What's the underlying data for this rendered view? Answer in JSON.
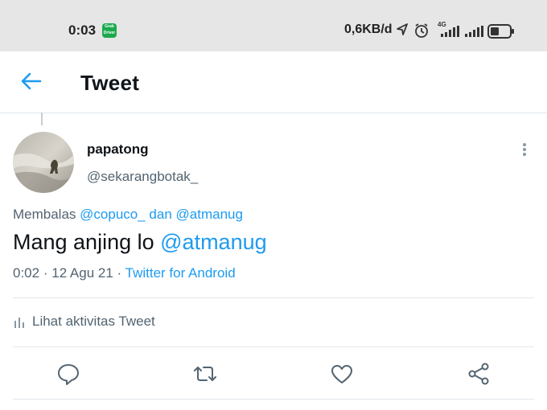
{
  "status_bar": {
    "time": "0:03",
    "grab_app_label": "Grab Driver",
    "network_speed": "0,6KB/d",
    "network_type": "4G",
    "icons": [
      "location-arrow-icon",
      "alarm-icon",
      "signal-4g-icon",
      "signal-icon",
      "battery-icon"
    ]
  },
  "header": {
    "title": "Tweet"
  },
  "tweet": {
    "author_name": "papatong",
    "author_handle": "@sekarangbotak_",
    "reply_prefix": "Membalas",
    "reply_mention_1": "@copuco_",
    "reply_conjunction": "dan",
    "reply_mention_2": "@atmanug",
    "text": "Mang anjing lo",
    "text_mention": "@atmanug",
    "time": "0:02",
    "separator": "·",
    "date": "12 Agu 21",
    "source": "Twitter for Android",
    "activity_label": "Lihat aktivitas Tweet"
  },
  "actions": [
    "reply-icon",
    "retweet-icon",
    "like-icon",
    "share-icon"
  ],
  "colors": {
    "accent": "#1d9bf0",
    "text_primary": "#0f1419",
    "text_secondary": "#536471",
    "status_bar_bg": "#e6e6e6",
    "divider": "#e1e8ed"
  }
}
